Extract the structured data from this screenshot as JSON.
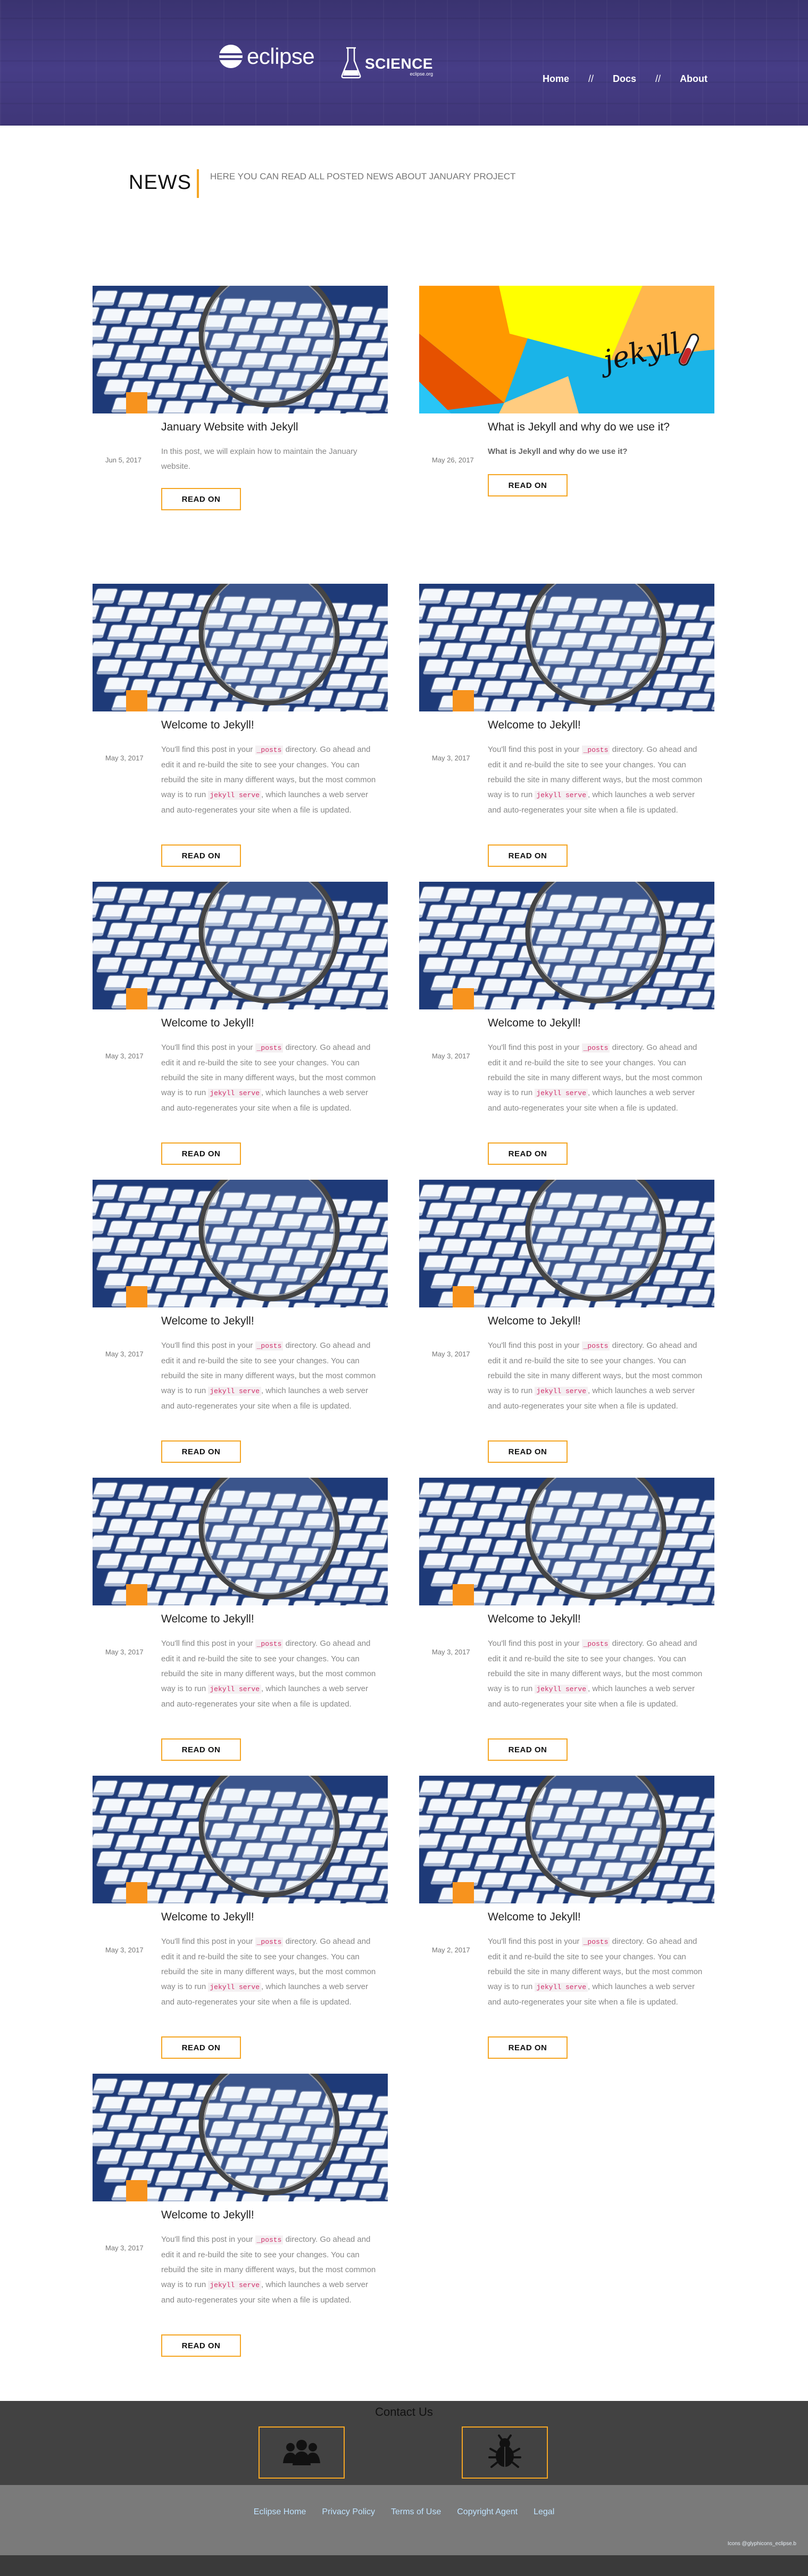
{
  "header": {
    "logo_eclipse": "eclipse",
    "logo_science": "SCIENCE",
    "logo_science_sub": "eclipse.org",
    "nav": [
      {
        "label": "Home"
      },
      {
        "label": "Docs"
      },
      {
        "label": "About"
      }
    ],
    "nav_separator": "//"
  },
  "news": {
    "title": "NEWS",
    "subtitle": "HERE YOU CAN READ ALL POSTED NEWS ABOUT JANUARY PROJECT"
  },
  "read_on_label": "READ ON",
  "welcome_body": {
    "p1": "You'll find this post in your ",
    "code1": "_posts",
    "p2": " directory. Go ahead and edit it and re-build the site to see your changes. You can rebuild the site in many different ways, but the most common way is to run ",
    "code2": "jekyll serve",
    "p3": ", which launches a web server and auto-regenerates your site when a file is updated."
  },
  "posts": [
    {
      "title": "January Website with Jekyll",
      "date": "Jun 5, 2017",
      "body": "In this post, we will explain how to maintain the January website.",
      "image": "keyboard-magnifier"
    },
    {
      "title": "What is Jekyll and why do we use it?",
      "date": "May 26, 2017",
      "body": "What is Jekyll and why do we use it?",
      "image": "jekyll-logo"
    },
    {
      "title": "Welcome to Jekyll!",
      "date": "May 3, 2017"
    },
    {
      "title": "Welcome to Jekyll!",
      "date": "May 3, 2017"
    },
    {
      "title": "Welcome to Jekyll!",
      "date": "May 3, 2017"
    },
    {
      "title": "Welcome to Jekyll!",
      "date": "May 3, 2017"
    },
    {
      "title": "Welcome to Jekyll!",
      "date": "May 3, 2017"
    },
    {
      "title": "Welcome to Jekyll!",
      "date": "May 3, 2017"
    },
    {
      "title": "Welcome to Jekyll!",
      "date": "May 3, 2017"
    },
    {
      "title": "Welcome to Jekyll!",
      "date": "May 3, 2017"
    },
    {
      "title": "Welcome to Jekyll!",
      "date": "May 3, 2017"
    },
    {
      "title": "Welcome to Jekyll!",
      "date": "May 2, 2017"
    },
    {
      "title": "Welcome to Jekyll!",
      "date": "May 3, 2017"
    }
  ],
  "jekyll_logo_text": "jekyll",
  "footer": {
    "contact": "Contact Us",
    "icons": [
      "people-group-icon",
      "bug-icon"
    ],
    "links": [
      "Eclipse Home",
      "Privacy Policy",
      "Terms of Use",
      "Copyright Agent",
      "Legal"
    ],
    "credit": "Icons @glyphicons_eclipse.b"
  },
  "colors": {
    "accent": "#f5a623",
    "header": "#463d86",
    "footer_dark": "#424242",
    "footer_mid": "#7a7a7a"
  }
}
